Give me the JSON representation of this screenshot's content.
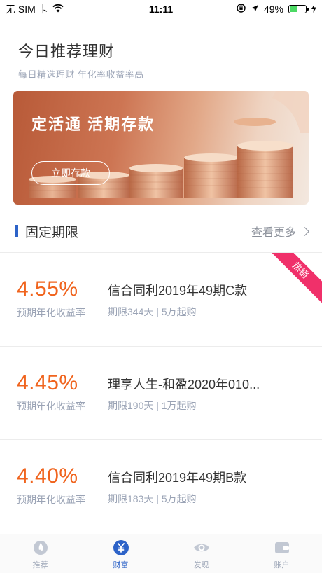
{
  "status_bar": {
    "carrier": "无 SIM 卡",
    "time": "11:11",
    "battery_text": "49%",
    "battery_level": 0.49
  },
  "header": {
    "title": "今日推荐理财",
    "subtitle": "每日精选理财 年化率收益率高"
  },
  "banner": {
    "title": "定活通 活期存款",
    "button_label": "立即存款"
  },
  "section": {
    "title": "固定期限",
    "more_label": "查看更多"
  },
  "products": [
    {
      "rate": "4.55%",
      "rate_label": "预期年化收益率",
      "name": "信合同利2019年49期C款",
      "meta": "期限344天 | 5万起购",
      "badge": "热销"
    },
    {
      "rate": "4.45%",
      "rate_label": "预期年化收益率",
      "name": "理享人生-和盈2020年010...",
      "meta": "期限190天 | 1万起购"
    },
    {
      "rate": "4.40%",
      "rate_label": "预期年化收益率",
      "name": "信合同利2019年49期B款",
      "meta": "期限183天 | 5万起购"
    }
  ],
  "tabs": [
    {
      "label": "推荐",
      "icon": "flame-icon"
    },
    {
      "label": "财富",
      "icon": "yuan-icon"
    },
    {
      "label": "发现",
      "icon": "eye-icon"
    },
    {
      "label": "账户",
      "icon": "wallet-icon"
    }
  ],
  "colors": {
    "accent": "#2d63c8",
    "rate": "#f0641e",
    "hot_badge": "#f0306a"
  }
}
